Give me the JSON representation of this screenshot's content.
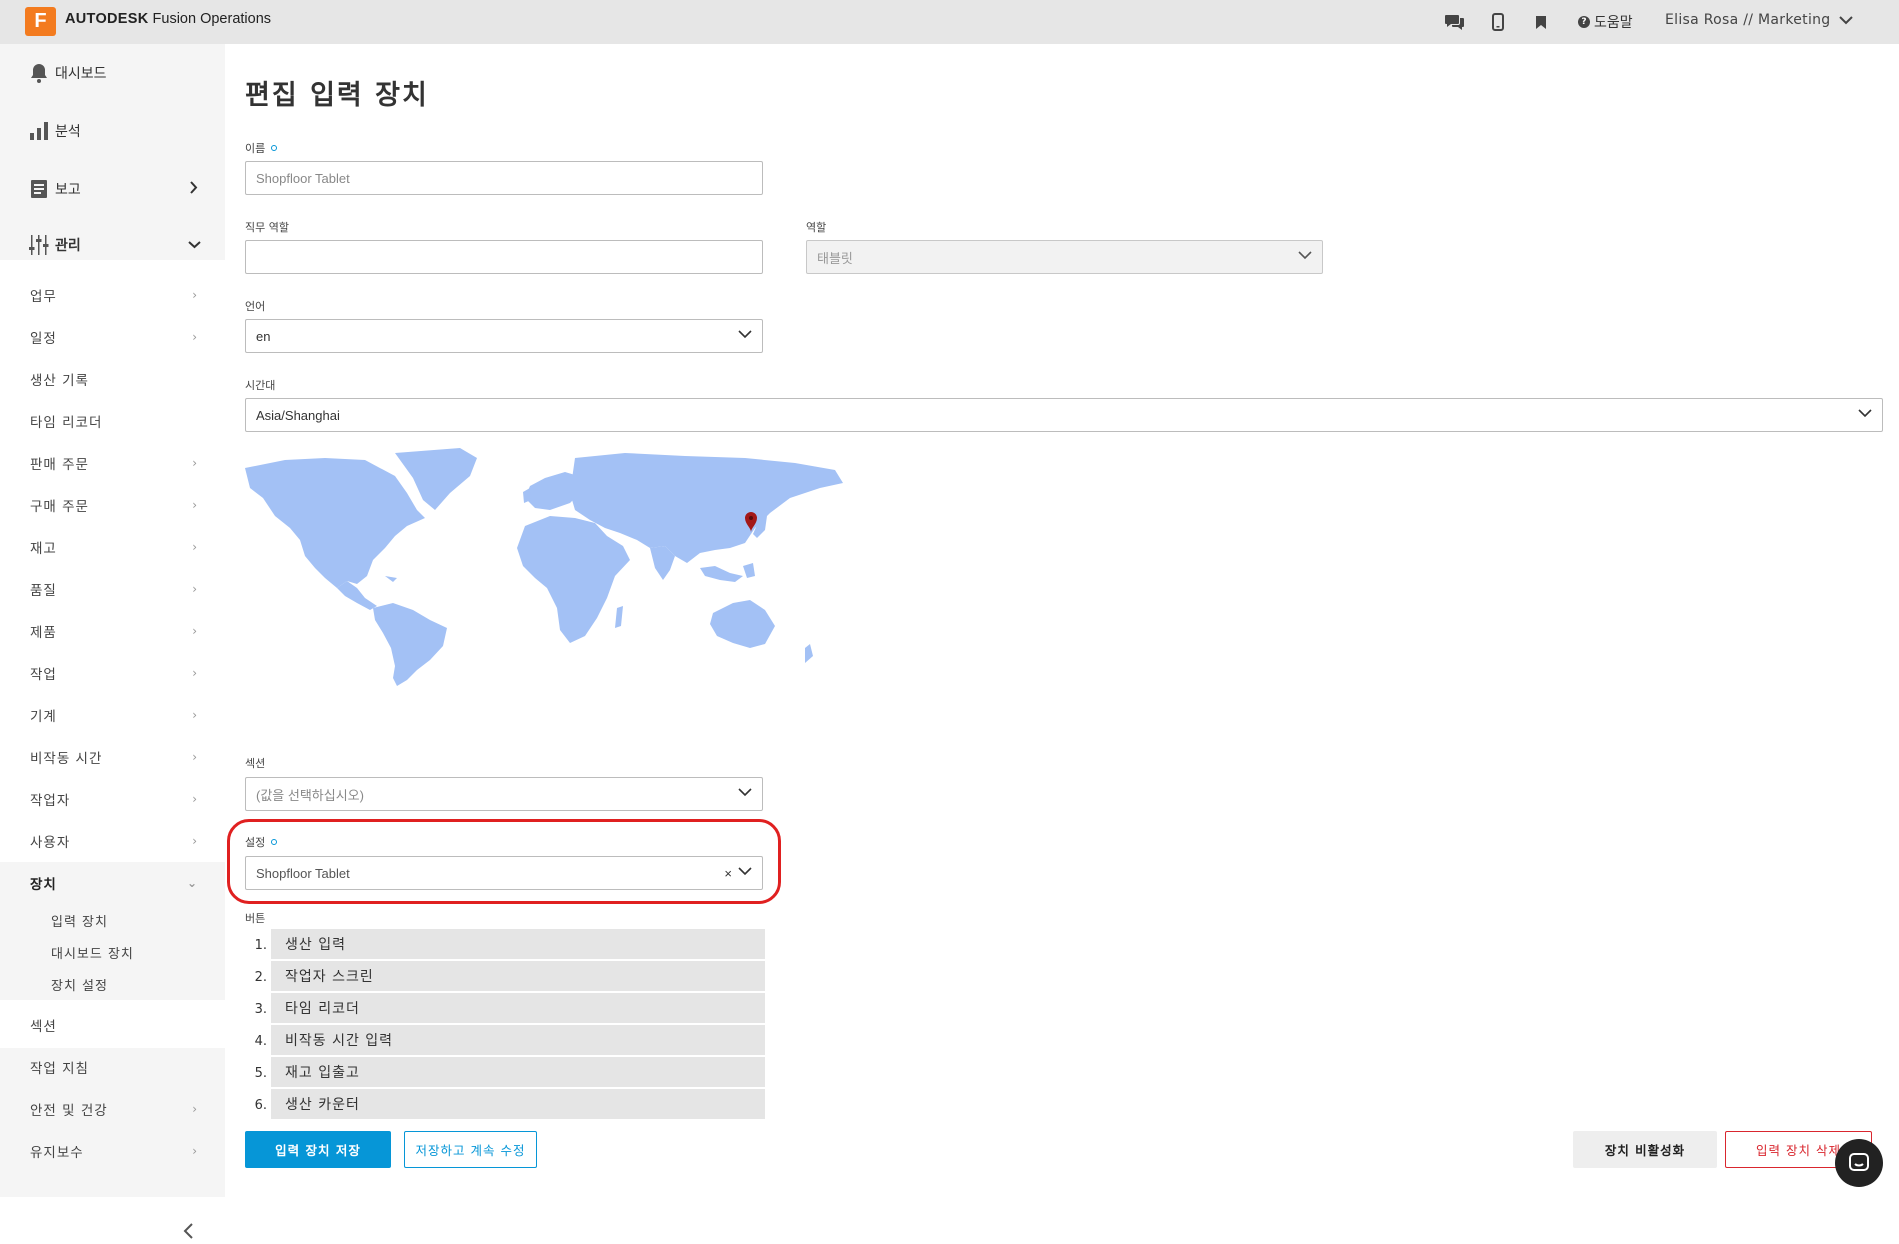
{
  "app": {
    "logo_letter": "F",
    "brand_bold": "AUTODESK",
    "brand_rest": " Fusion Operations",
    "help_label": "도움말",
    "user_label": "Elisa Rosa // Marketing"
  },
  "sidebar": {
    "main_items": [
      {
        "label": "대시보드",
        "icon": "bell-icon"
      },
      {
        "label": "분석",
        "icon": "bar-chart-icon"
      },
      {
        "label": "보고",
        "icon": "report-icon"
      },
      {
        "label": "관리",
        "icon": "sliders-icon"
      }
    ],
    "sub_items": [
      {
        "label": "업무",
        "arrow": true
      },
      {
        "label": "일정",
        "arrow": true
      },
      {
        "label": "생산 기록",
        "arrow": false
      },
      {
        "label": "타임 리코더",
        "arrow": false
      },
      {
        "label": "판매 주문",
        "arrow": true
      },
      {
        "label": "구매 주문",
        "arrow": true
      },
      {
        "label": "재고",
        "arrow": true
      },
      {
        "label": "품질",
        "arrow": true
      },
      {
        "label": "제품",
        "arrow": true
      },
      {
        "label": "작업",
        "arrow": true
      },
      {
        "label": "기계",
        "arrow": true
      },
      {
        "label": "비작동 시간",
        "arrow": true
      },
      {
        "label": "작업자",
        "arrow": true
      },
      {
        "label": "사용자",
        "arrow": true
      },
      {
        "label": "장치",
        "arrow": true
      },
      {
        "label": "섹션",
        "arrow": false
      },
      {
        "label": "작업 지침",
        "arrow": false
      },
      {
        "label": "안전 및 건강",
        "arrow": true
      },
      {
        "label": "유지보수",
        "arrow": true
      }
    ],
    "device_children": [
      "입력 장치",
      "대시보드 장치",
      "장치 설정"
    ]
  },
  "form": {
    "title": "편집 입력 장치",
    "name_label": "이름",
    "name_value": "Shopfloor Tablet",
    "job_role_label": "직무 역할",
    "job_role_value": "",
    "role_label": "역할",
    "role_value": "태블릿",
    "language_label": "언어",
    "language_value": "en",
    "timezone_label": "시간대",
    "timezone_value": "Asia/Shanghai",
    "section_label": "섹션",
    "section_placeholder": "(값을 선택하십시오)",
    "settings_label": "설정",
    "settings_value": "Shopfloor Tablet",
    "settings_clear": "×",
    "buttons_label": "버튼",
    "buttons": [
      {
        "num": "1.",
        "label": "생산 입력"
      },
      {
        "num": "2.",
        "label": "작업자 스크린"
      },
      {
        "num": "3.",
        "label": "타임 리코더"
      },
      {
        "num": "4.",
        "label": "비작동 시간 입력"
      },
      {
        "num": "5.",
        "label": "재고 입출고"
      },
      {
        "num": "6.",
        "label": "생산 카운터"
      }
    ]
  },
  "actions": {
    "save": "입력 장치 저장",
    "save_continue": "저장하고 계속 수정",
    "deactivate": "장치 비활성화",
    "delete": "입력 장치 삭제"
  },
  "colors": {
    "accent": "#0696d7",
    "danger": "#d9262e",
    "highlight": "#e02020",
    "map_land": "#a3c1f5",
    "brand": "#f37b1f"
  }
}
